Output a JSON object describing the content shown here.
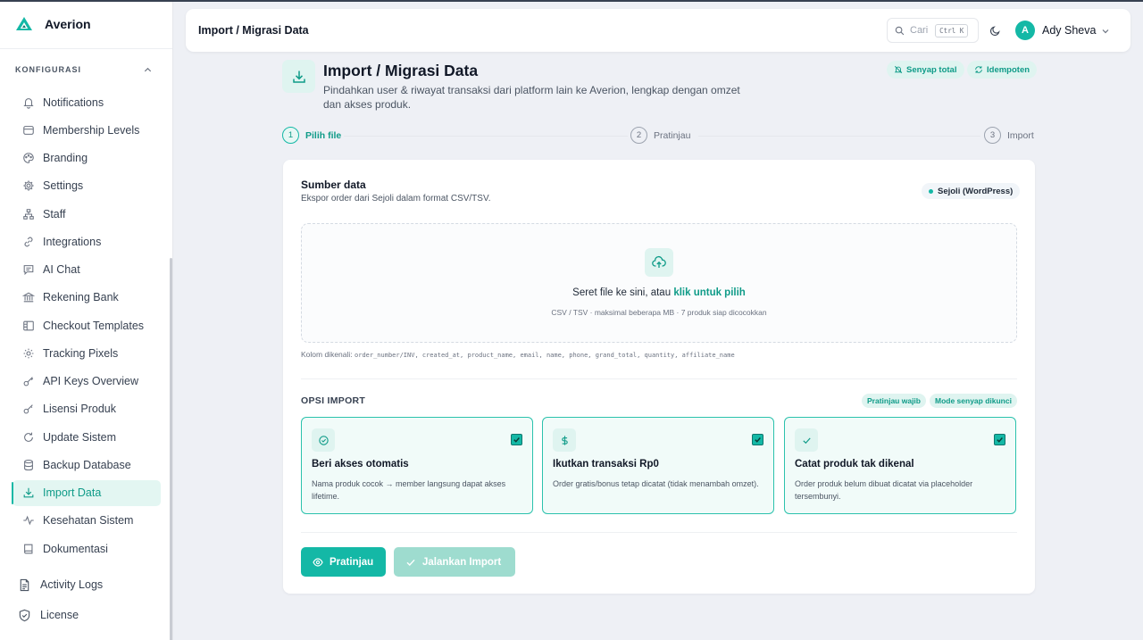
{
  "app": {
    "name": "Averion"
  },
  "sidebar": {
    "section_label": "KONFIGURASI",
    "items": [
      {
        "label": "Notifications",
        "icon": "bell-icon"
      },
      {
        "label": "Membership Levels",
        "icon": "layers-icon"
      },
      {
        "label": "Branding",
        "icon": "palette-icon"
      },
      {
        "label": "Settings",
        "icon": "gear-icon"
      },
      {
        "label": "Staff",
        "icon": "org-chart-icon"
      },
      {
        "label": "Integrations",
        "icon": "link-icon"
      },
      {
        "label": "AI Chat",
        "icon": "chat-icon"
      },
      {
        "label": "Rekening Bank",
        "icon": "bank-icon"
      },
      {
        "label": "Checkout Templates",
        "icon": "layout-icon"
      },
      {
        "label": "Tracking Pixels",
        "icon": "sun-icon"
      },
      {
        "label": "API Keys Overview",
        "icon": "key-icon"
      },
      {
        "label": "Lisensi Produk",
        "icon": "key-icon"
      },
      {
        "label": "Update Sistem",
        "icon": "refresh-icon"
      },
      {
        "label": "Backup Database",
        "icon": "database-icon"
      },
      {
        "label": "Import Data",
        "icon": "download-icon",
        "active": true
      },
      {
        "label": "Kesehatan Sistem",
        "icon": "activity-icon"
      },
      {
        "label": "Dokumentasi",
        "icon": "book-icon"
      }
    ],
    "bottom": [
      {
        "label": "Activity Logs",
        "icon": "file-text-icon"
      },
      {
        "label": "License",
        "icon": "shield-icon"
      }
    ]
  },
  "header": {
    "breadcrumb": "Import / Migrasi Data",
    "search_placeholder": "Cari",
    "search_shortcut": "Ctrl K",
    "user_initial": "A",
    "user_name": "Ady Sheva"
  },
  "page": {
    "title": "Import / Migrasi Data",
    "description": "Pindahkan user & riwayat transaksi dari platform lain ke Averion, lengkap dengan omzet dan akses produk.",
    "badges": [
      "Senyap total",
      "Idempoten"
    ]
  },
  "steps": [
    {
      "num": "1",
      "label": "Pilih file",
      "active": true
    },
    {
      "num": "2",
      "label": "Pratinjau",
      "active": false
    },
    {
      "num": "3",
      "label": "Import",
      "active": false
    }
  ],
  "source": {
    "title": "Sumber data",
    "subtitle": "Ekspor order dari Sejoli dalam format CSV/TSV.",
    "platform": "Sejoli (WordPress)"
  },
  "dropzone": {
    "text": "Seret file ke sini, atau ",
    "link": "klik untuk pilih",
    "hint": "CSV / TSV · maksimal beberapa MB · 7 produk siap dicocokkan"
  },
  "columns": {
    "label": "Kolom dikenali: ",
    "value": "order_number/INV, created_at, product_name, email, name, phone, grand_total, quantity, affiliate_name"
  },
  "options": {
    "title": "OPSI IMPORT",
    "badges": [
      "Pratinjau wajib",
      "Mode senyap dikunci"
    ],
    "items": [
      {
        "title": "Beri akses otomatis",
        "desc": "Nama produk cocok → member langsung dapat akses lifetime.",
        "icon": "check-circle-icon",
        "checked": true
      },
      {
        "title": "Ikutkan transaksi Rp0",
        "desc": "Order gratis/bonus tetap dicatat (tidak menambah omzet).",
        "icon": "dollar-icon",
        "checked": true
      },
      {
        "title": "Catat produk tak dikenal",
        "desc": "Order produk belum dibuat dicatat via placeholder tersembunyi.",
        "icon": "check-icon",
        "checked": true
      }
    ]
  },
  "buttons": {
    "preview": "Pratinjau",
    "run": "Jalankan Import"
  },
  "colors": {
    "accent": "#14b8a6",
    "accent_dark": "#0f9b88",
    "accent_soft": "#dff4f0"
  }
}
